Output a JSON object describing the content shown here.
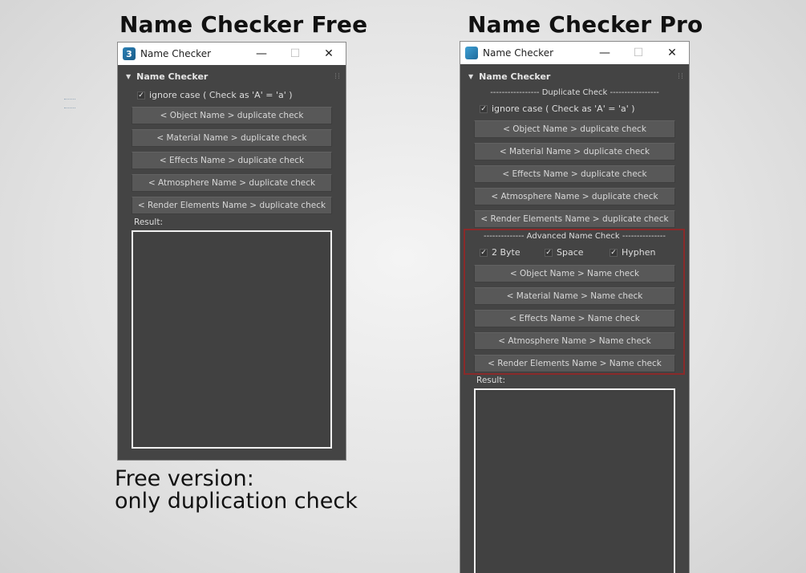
{
  "free": {
    "heading": "Name Checker Free",
    "window_title": "Name Checker",
    "app_icon_glyph": "3",
    "rollout_title": "Name Checker",
    "ignore_case_label": "ignore case ( Check as 'A' = 'a' )",
    "ignore_case_checked": true,
    "buttons": [
      "< Object Name > duplicate check",
      "< Material Name > duplicate check",
      "< Effects Name > duplicate check",
      "< Atmosphere Name > duplicate check",
      "< Render Elements Name > duplicate check"
    ],
    "result_label": "Result:",
    "caption_line1": "Free version:",
    "caption_line2": "only duplication check"
  },
  "pro": {
    "heading": "Name Checker Pro",
    "window_title": "Name Checker",
    "rollout_title": "Name Checker",
    "duplicate_separator": "----------------- Duplicate Check -----------------",
    "ignore_case_label": "ignore case ( Check as 'A' = 'a' )",
    "ignore_case_checked": true,
    "duplicate_buttons": [
      "< Object Name > duplicate check",
      "< Material Name > duplicate check",
      "< Effects Name > duplicate check",
      "< Atmosphere Name > duplicate check",
      "< Render Elements Name > duplicate check"
    ],
    "advanced_separator": "-------------- Advanced Name Check ---------------",
    "options": [
      {
        "label": "2 Byte",
        "checked": true
      },
      {
        "label": "Space",
        "checked": true
      },
      {
        "label": "Hyphen",
        "checked": true
      }
    ],
    "name_buttons": [
      "< Object Name > Name check",
      "< Material Name > Name check",
      "< Effects Name > Name check",
      "< Atmosphere Name > Name check",
      "< Render Elements Name > Name check"
    ],
    "result_label": "Result:"
  },
  "window_controls": {
    "minimize": "—",
    "maximize": "☐",
    "close": "✕"
  },
  "colors": {
    "panel_bg": "#444444",
    "button_bg": "#585858",
    "highlight_border": "#8a2a2a",
    "result_border": "#f0f0f0"
  }
}
